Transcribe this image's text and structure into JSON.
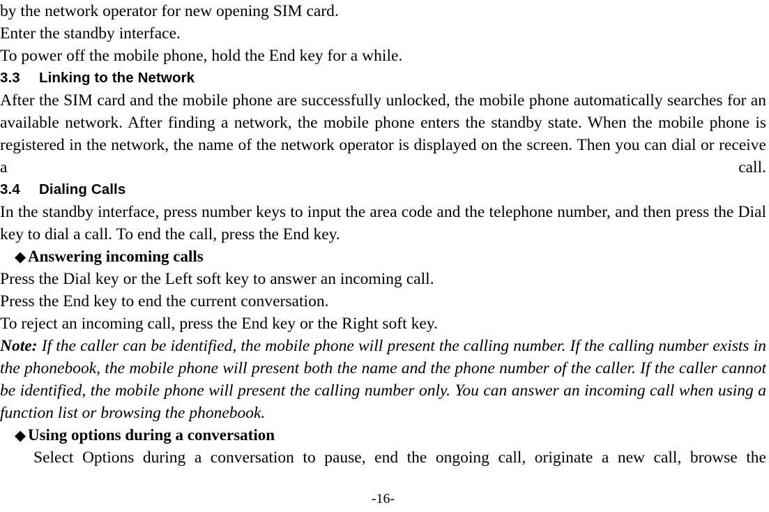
{
  "document": {
    "page_number_label": "-16-",
    "body": {
      "intro_lines": [
        "by the network operator for new opening SIM card.",
        "Enter the standby interface.",
        "To power off the mobile phone, hold the End key for a while."
      ],
      "section_3_3": {
        "number": "3.3",
        "title": "Linking to the Network",
        "paragraph": "After the SIM card and the mobile phone are successfully unlocked, the mobile phone automatically searches for an available network. After finding a network, the mobile phone enters the standby state. When the mobile phone is registered in the network, the name of the network operator is displayed on the screen. Then you can dial or receive a call."
      },
      "section_3_4": {
        "number": "3.4",
        "title": "Dialing Calls",
        "paragraph": "In the standby interface, press number keys to input the area code and the telephone number, and then press the Dial key to dial a call. To end the call, press the End key.",
        "bullet_1": {
          "glyph": "◆",
          "glyph_name": "diamond-bullet-icon",
          "heading": "Answering incoming calls",
          "lines": [
            "Press the Dial key or the Left soft key to answer an incoming call.",
            "Press the End key to end the current conversation.",
            "To reject an incoming call, press the End key or the Right soft key."
          ],
          "note_label": "Note:",
          "note_text": " If the caller can be identified, the mobile phone will present the calling number. If the calling number exists in the phonebook, the mobile phone will present both the name and the phone number of the caller. If the caller cannot be identified, the mobile phone will present the calling number only. You can answer an incoming call when using a function list or browsing the phonebook."
        },
        "bullet_2": {
          "glyph": "◆",
          "glyph_name": "diamond-bullet-icon",
          "heading": "Using options during a conversation",
          "paragraph": "Select Options during a conversation to pause, end the ongoing call, originate a new call, browse the"
        }
      }
    }
  }
}
